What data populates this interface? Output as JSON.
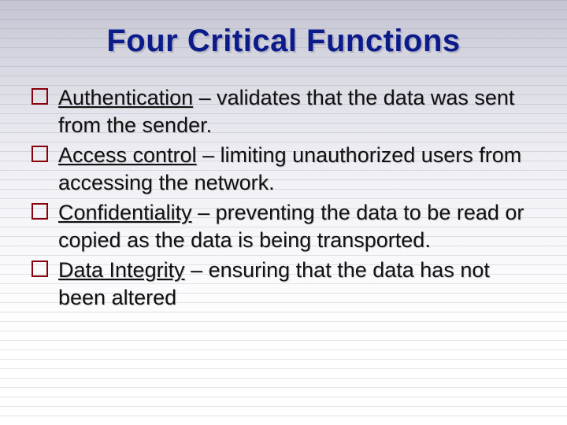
{
  "title": "Four Critical Functions",
  "items": [
    {
      "term": "Authentication",
      "desc": " – validates that the data was sent from the sender."
    },
    {
      "term": "Access control",
      "desc": " – limiting unauthorized users from accessing the network."
    },
    {
      "term": "Confidentiality",
      "desc": " – preventing the data to be read or copied as the data is being transported."
    },
    {
      "term": "Data Integrity",
      "desc": " – ensuring that the data has not been altered"
    }
  ],
  "colors": {
    "title": "#0b1b8a",
    "bullet_border": "#88000c"
  }
}
